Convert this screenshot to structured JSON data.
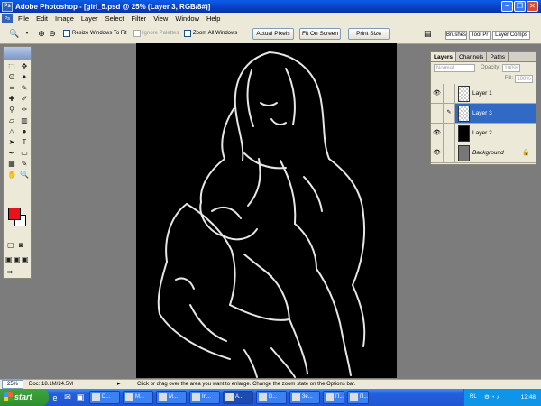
{
  "window": {
    "title": "Adobe Photoshop - [girl_5.psd @ 25% (Layer 3, RGB/8#)]",
    "app_icon": "Ps"
  },
  "menu": {
    "items": [
      "File",
      "Edit",
      "Image",
      "Layer",
      "Select",
      "Filter",
      "View",
      "Window",
      "Help"
    ]
  },
  "options": {
    "resize_label": "Resize Windows To Fit",
    "ignore_palettes_label": "Ignore Palettes",
    "zoom_all_label": "Zoom All Windows",
    "actual_pixels": "Actual Pixels",
    "fit_on_screen": "Fit On Screen",
    "print_size": "Print Size"
  },
  "palette_well": {
    "tabs": [
      "Brushes",
      "Tool Pr",
      "Layer Comps"
    ]
  },
  "layers_panel": {
    "tabs": [
      "Layers",
      "Channels",
      "Paths"
    ],
    "blend_mode": "Normal",
    "opacity_label": "Opacity:",
    "opacity_value": "100%",
    "fill_label": "Fill:",
    "fill_value": "100%",
    "layers": [
      {
        "name": "Layer 1",
        "selected": false
      },
      {
        "name": "Layer 3",
        "selected": true
      },
      {
        "name": "Layer 2",
        "selected": false
      },
      {
        "name": "Background",
        "selected": false
      }
    ]
  },
  "colors": {
    "foreground": "#e8121a",
    "background": "#ffffff",
    "canvas": "#000000",
    "selection": "#316ac5"
  },
  "status": {
    "zoom": "25%",
    "doc": "Doc: 18.1M/24.5M",
    "hint": "Click or drag over the area you want to enlarge. Change the zoom state on the Options bar."
  },
  "taskbar": {
    "start": "start",
    "tasks": [
      "D...",
      "M...",
      "M...",
      "In...",
      "A...",
      "D...",
      "3e...",
      "П...",
      "П..."
    ],
    "lang": "RL",
    "clock": "12:48"
  }
}
